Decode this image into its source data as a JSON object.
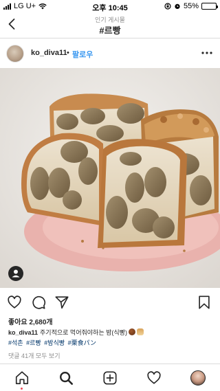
{
  "status_bar": {
    "carrier": "LG U+",
    "time": "오후 10:45",
    "battery": "55%",
    "battery_level": 0.55,
    "icons": [
      "signal-icon",
      "wifi-icon",
      "rotation-lock-icon",
      "alarm-icon",
      "battery-icon"
    ]
  },
  "header": {
    "subtitle": "인기 게시물",
    "title": "#르빵",
    "back_icon": "chevron-left-icon"
  },
  "post": {
    "username": "ko_diva11",
    "separator": "•",
    "follow_label": "팔로우",
    "more_icon": "more-horizontal-icon",
    "image_description_icon": "user-tag-icon"
  },
  "actions": {
    "icons": [
      "heart-icon",
      "comment-icon",
      "share-icon",
      "bookmark-icon"
    ]
  },
  "likes": "좋아요 2,680개",
  "caption": {
    "username": "ko_diva11",
    "text": "주기적으로 먹어줘야하는 밤(식빵)"
  },
  "hashtags": [
    "#석촌",
    "#르빵",
    "#밤식빵",
    "#栗食パン"
  ],
  "comments_link": "댓글 41개 모두 보기",
  "tabbar": {
    "icons": [
      "home-icon",
      "search-icon",
      "new-post-icon",
      "activity-heart-icon",
      "profile-avatar"
    ]
  },
  "colors": {
    "link_blue": "#3897f0",
    "hashtag": "#003569",
    "muted": "#8e8e8e",
    "text": "#262626",
    "notification": "#ed4956"
  }
}
